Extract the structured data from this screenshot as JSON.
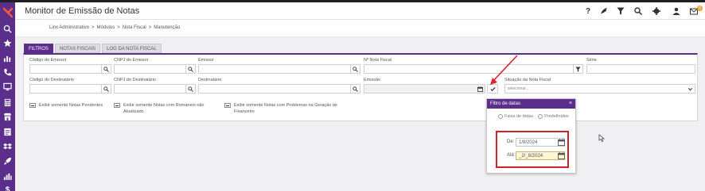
{
  "header": {
    "title": "Monitor de Emissão de Notas",
    "help_label": "?",
    "badge_count": "0"
  },
  "breadcrumb": [
    "Linx Administrativo",
    ">",
    "Módulos",
    ">",
    "Nota Fiscal",
    ">",
    "Manutenção"
  ],
  "tabs": [
    {
      "label": "FILTROS",
      "active": true
    },
    {
      "label": "NOTAS FISCAIS",
      "active": false
    },
    {
      "label": "LOG DA NOTA FISCAL",
      "active": false
    }
  ],
  "filters": {
    "row1": {
      "codigo_emissor": "Código do Emissor",
      "cnpj_emissor": "CNPJ do Emissor",
      "emissor": "Emissor",
      "numero_nf": "Nº Nota Fiscal",
      "serie": "Série"
    },
    "row2": {
      "codigo_destinatario": "Código do Destinatário",
      "cnpj_destinatario": "CNPJ do Destinatário",
      "destinatario": "Destinatário",
      "emissao": "Emissão",
      "situacao": "Situação da Nota Fiscal",
      "situacao_placeholder": "selecionar..."
    },
    "checks": [
      "Exibir somente Notas Pendentes",
      "Exibir somente Notas com Romaneio não Atualizado",
      "Exibir somente Notas com Problemas na Geração de Financeiro"
    ]
  },
  "date_popup": {
    "title": "Filtro de datas",
    "close": "×",
    "radio_range": "Faixa de datas",
    "radio_predefined": "Predefinidos",
    "from_label": "De:",
    "from_value": "1/8/2024",
    "to_label": "Até:",
    "to_value": "_2/_8/2024"
  },
  "colors": {
    "brand": "#5b2e8c",
    "highlight": "#d0202a",
    "badge": "#f0a030"
  }
}
